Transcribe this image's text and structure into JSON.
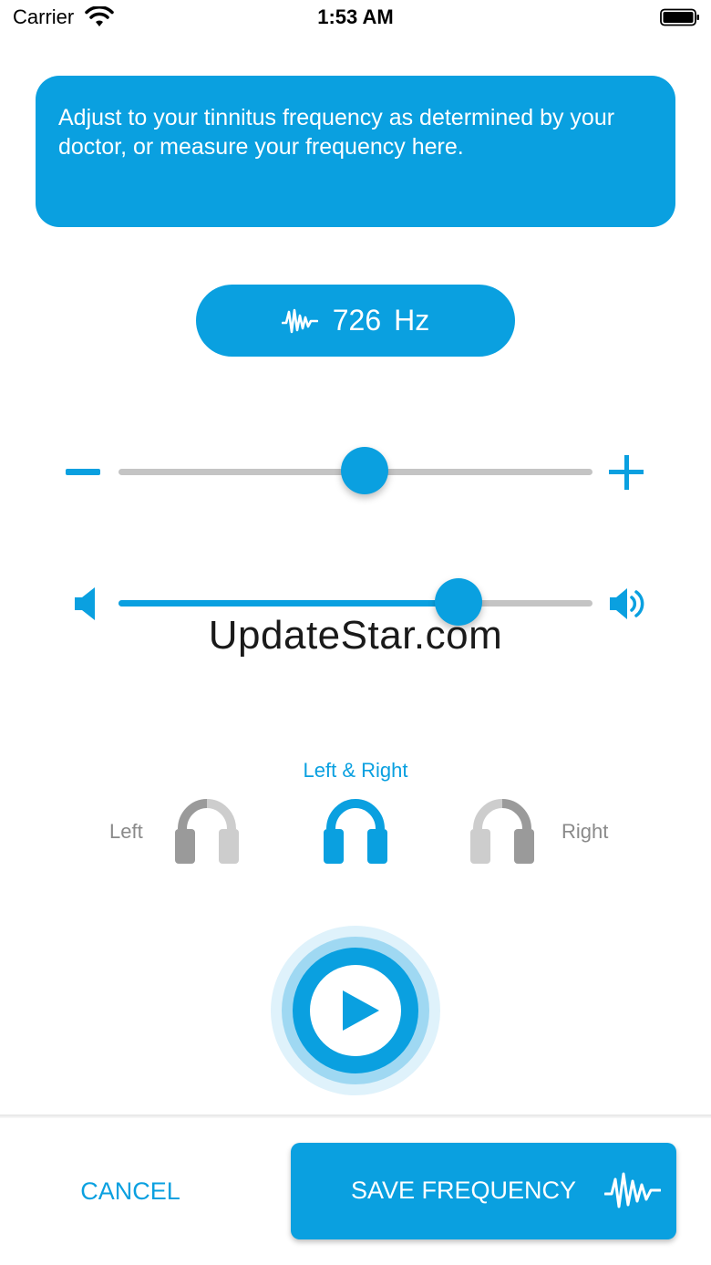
{
  "status_bar": {
    "carrier": "Carrier",
    "time": "1:53 AM",
    "icons": [
      "wifi-icon",
      "battery-icon"
    ]
  },
  "info_card": {
    "text": "Adjust to your tinnitus frequency as determined by your doctor, or measure your frequency here."
  },
  "frequency": {
    "value": "726",
    "unit": "Hz",
    "icon": "waveform-icon"
  },
  "frequency_slider": {
    "position": 0.52,
    "decrease_icon": "minus-icon",
    "increase_icon": "plus-icon"
  },
  "volume_slider": {
    "position": 0.72,
    "low_icon": "speaker-low-icon",
    "high_icon": "speaker-high-icon"
  },
  "watermark": "UpdateStar.com",
  "output_selector": {
    "selected_label": "Left & Right",
    "left_label": "Left",
    "right_label": "Right",
    "selected": "both"
  },
  "play_button": {
    "icon": "play-icon"
  },
  "actions": {
    "cancel_label": "CANCEL",
    "save_label": "SAVE FREQUENCY",
    "save_icon": "waveform-icon"
  },
  "colors": {
    "accent": "#0aa0e0",
    "track": "#c4c4c4",
    "inactive_icon": "#9a9a9a",
    "inactive_icon_light": "#cdcdcd"
  }
}
